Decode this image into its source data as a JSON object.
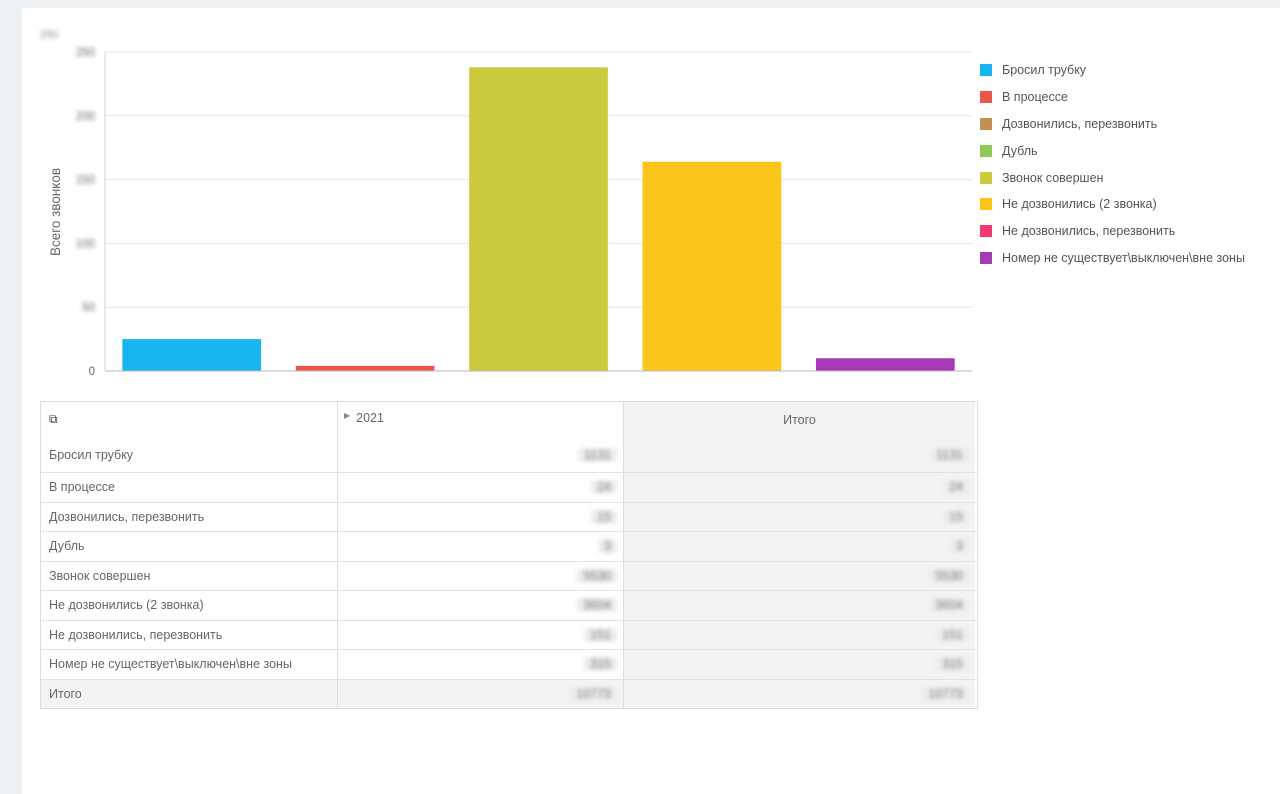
{
  "chart_data": {
    "type": "bar",
    "title": "",
    "ylabel": "Всего звонков",
    "xlabel": "",
    "ylim": [
      0,
      250
    ],
    "yticks": [
      0,
      50,
      100,
      150,
      200,
      250
    ],
    "ytick_labels": [
      "0",
      "50",
      "100",
      "150",
      "200",
      "250"
    ],
    "grid": true,
    "legend_position": "right",
    "categories": [
      "Бросил трубку",
      "В процессе",
      "Дозвонились, перезвонить",
      "Дубль",
      "Звонок совершен",
      "Не дозвонились (2 звонка)",
      "Не дозвонились, перезвонить",
      "Номер не существует\\выключен\\вне зоны"
    ],
    "series": [
      {
        "name": "Бросил трубку",
        "color": "#18b4ef",
        "values": [
          25
        ]
      },
      {
        "name": "В процессе",
        "color": "#e8574a",
        "values": [
          4
        ]
      },
      {
        "name": "Дозвонились, перезвонить",
        "color": "#c49052",
        "values": [
          0
        ]
      },
      {
        "name": "Дубль",
        "color": "#8fc95a",
        "values": [
          0
        ]
      },
      {
        "name": "Звонок совершен",
        "color": "#cbca3e",
        "values": [
          238
        ]
      },
      {
        "name": "Не дозвонились (2 звонка)",
        "color": "#fcc51c",
        "values": [
          164
        ]
      },
      {
        "name": "Не дозвонились, перезвонить",
        "color": "#ee3a6f",
        "values": [
          0
        ]
      },
      {
        "name": "Номер не существует\\выключен\\вне зоны",
        "color": "#a63ab4",
        "values": [
          10
        ]
      }
    ]
  },
  "pivot": {
    "year_label": "2021",
    "total_label": "Итого",
    "rows": [
      {
        "label": "Бросил трубку",
        "year_value": "1131",
        "total_value": "1131"
      },
      {
        "label": "В процессе",
        "year_value": "24",
        "total_value": "24"
      },
      {
        "label": "Дозвонились, перезвонить",
        "year_value": "15",
        "total_value": "15"
      },
      {
        "label": "Дубль",
        "year_value": "3",
        "total_value": "3"
      },
      {
        "label": "Звонок совершен",
        "year_value": "5530",
        "total_value": "5530"
      },
      {
        "label": "Не дозвонились (2 звонка)",
        "year_value": "3604",
        "total_value": "3604"
      },
      {
        "label": "Не дозвонились, перезвонить",
        "year_value": "151",
        "total_value": "151"
      },
      {
        "label": "Номер не существует\\выключен\\вне зоны",
        "year_value": "315",
        "total_value": "315"
      }
    ],
    "total_row": {
      "label": "Итого",
      "year_value": "10773",
      "total_value": "10773"
    }
  },
  "icons": {
    "pivot_fields": "pivot-fields-icon",
    "expand": "expand-arrow-icon"
  }
}
